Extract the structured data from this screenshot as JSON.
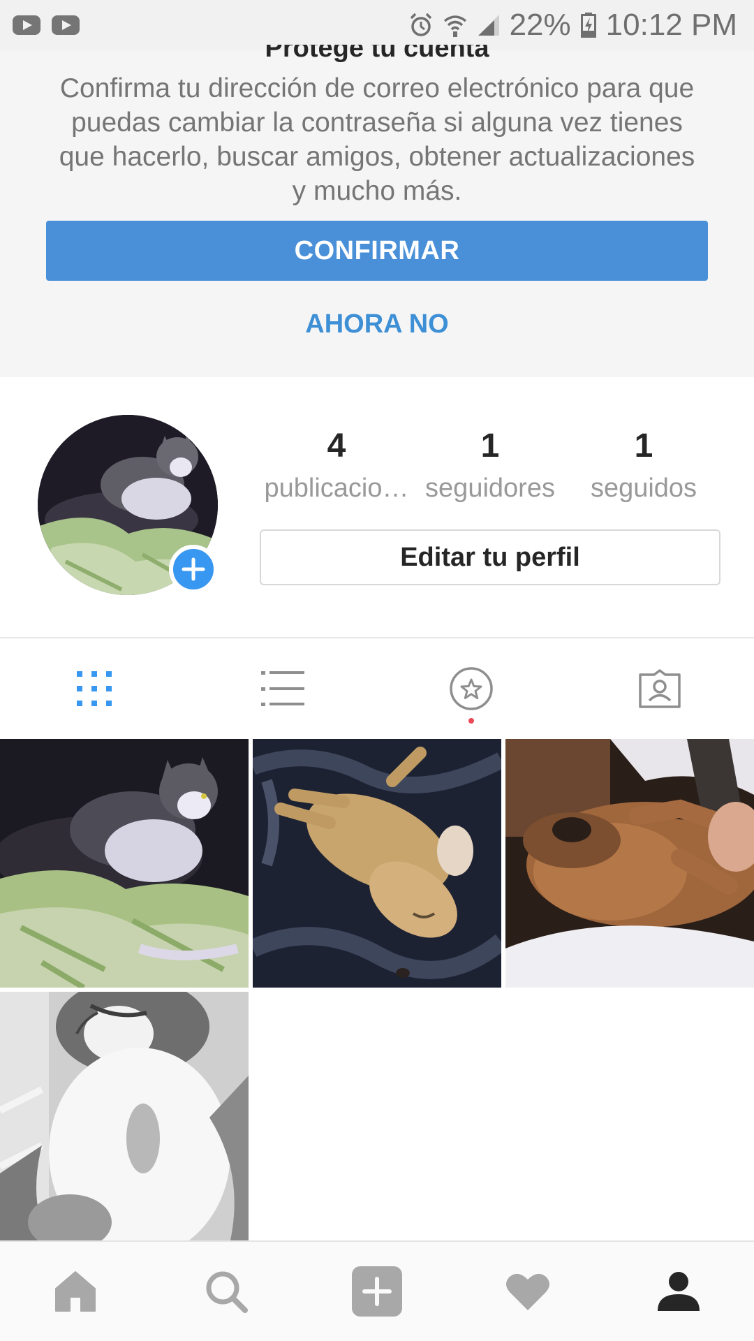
{
  "status_bar": {
    "notification_icons": [
      "youtube-icon",
      "youtube-icon"
    ],
    "system_icons": [
      "alarm-icon",
      "wifi-icon",
      "signal-icon"
    ],
    "battery": "22%",
    "time": "10:12 PM"
  },
  "protect_card": {
    "title": "Protege tu cuenta",
    "body": "Confirma tu dirección de correo electrónico para que puedas cambiar la contraseña si alguna vez tienes que hacerlo, buscar amigos, obtener actualizaciones y mucho más.",
    "confirm_label": "CONFIRMAR",
    "later_label": "AHORA NO"
  },
  "profile": {
    "stats": [
      {
        "count": "4",
        "label": "publicacio…"
      },
      {
        "count": "1",
        "label": "seguidores"
      },
      {
        "count": "1",
        "label": "seguidos"
      }
    ],
    "edit_label": "Editar tu perfil"
  },
  "view_tabs": {
    "items": [
      "grid-icon",
      "list-icon",
      "saved-star-icon",
      "tagged-icon"
    ],
    "active": "grid-icon"
  },
  "posts": [
    "cat-on-bed",
    "sleeping-dog",
    "dachshund-on-blanket",
    "black-white-cat"
  ],
  "bottom_nav": {
    "items": [
      "home-icon",
      "search-icon",
      "add-post-icon",
      "activity-heart-icon",
      "profile-icon"
    ],
    "active": "profile-icon"
  },
  "colors": {
    "accent_blue": "#3897f0",
    "confirm_button": "#4a90d9",
    "notification_dot": "#ed4956",
    "icon_gray": "#a8a8a8"
  }
}
